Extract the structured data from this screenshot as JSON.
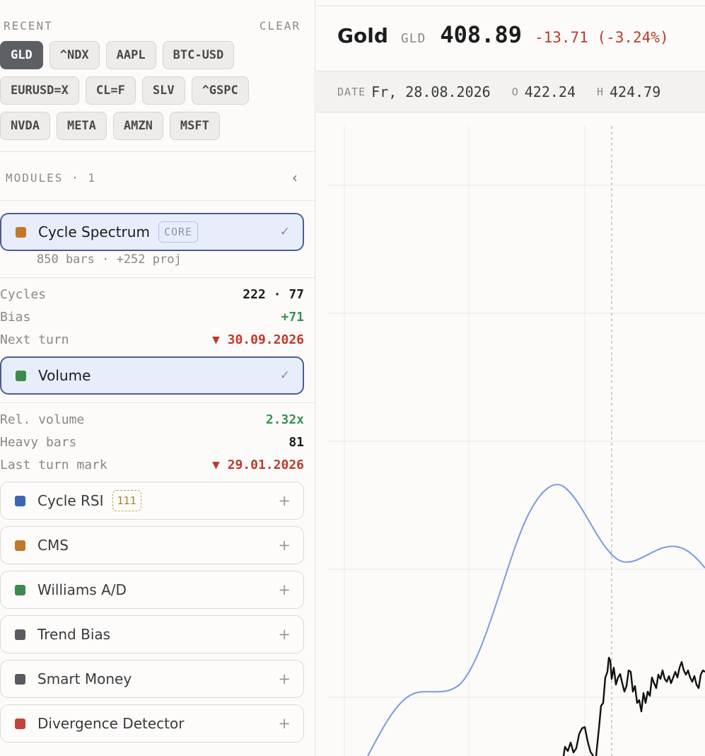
{
  "sidebar": {
    "recent_label": "RECENT",
    "clear_label": "CLEAR",
    "chips": [
      [
        "GLD",
        "^NDX",
        "AAPL",
        "BTC-USD"
      ],
      [
        "EURUSD=X",
        "CL=F",
        "SLV",
        "^GSPC"
      ],
      [
        "NVDA",
        "META",
        "AMZN",
        "MSFT"
      ]
    ],
    "active_chip": "GLD",
    "modules_label": "MODULES · 1",
    "collapse_icon": "‹",
    "cycle_spectrum": {
      "name": "Cycle Spectrum",
      "tag": "CORE",
      "check": "✓",
      "color": "#c0782a",
      "subline": "850 bars · +252 proj",
      "stats": {
        "cycles_k": "Cycles",
        "cycles_v": "222 · 77",
        "bias_k": "Bias",
        "bias_v": "+71",
        "next_k": "Next turn",
        "next_v": "▼ 30.09.2026"
      }
    },
    "volume": {
      "name": "Volume",
      "check": "✓",
      "color": "#3d8a4f",
      "stats": {
        "rel_k": "Rel. volume",
        "rel_v": "2.32x",
        "heavy_k": "Heavy bars",
        "heavy_v": "81",
        "last_k": "Last turn mark",
        "last_v": "▼ 29.01.2026"
      }
    },
    "other_modules": [
      {
        "name": "Cycle RSI",
        "tag": "111",
        "color": "#3b65b0",
        "action": "+"
      },
      {
        "name": "CMS",
        "color": "#c0782a",
        "action": "+"
      },
      {
        "name": "Williams A/D",
        "color": "#3d8a4f",
        "action": "+"
      },
      {
        "name": "Trend Bias",
        "color": "#5a5a60",
        "action": "+"
      },
      {
        "name": "Smart Money",
        "color": "#5a5a60",
        "action": "+"
      },
      {
        "name": "Divergence Detector",
        "color": "#c0443a",
        "action": "+"
      }
    ]
  },
  "header": {
    "name": "Gold",
    "ticker": "GLD",
    "price": "408.89",
    "change": "-13.71 (-3.24%)"
  },
  "info": {
    "date_label": "DATE",
    "date_value": "Fr, 28.08.2026",
    "open_label": "O",
    "open_value": "422.24",
    "high_label": "H",
    "high_value": "424.79"
  },
  "colors": {
    "accent_blue": "#7b9ae0",
    "price_line": "#111111",
    "negative": "#c0392b",
    "positive": "#3d9150"
  }
}
